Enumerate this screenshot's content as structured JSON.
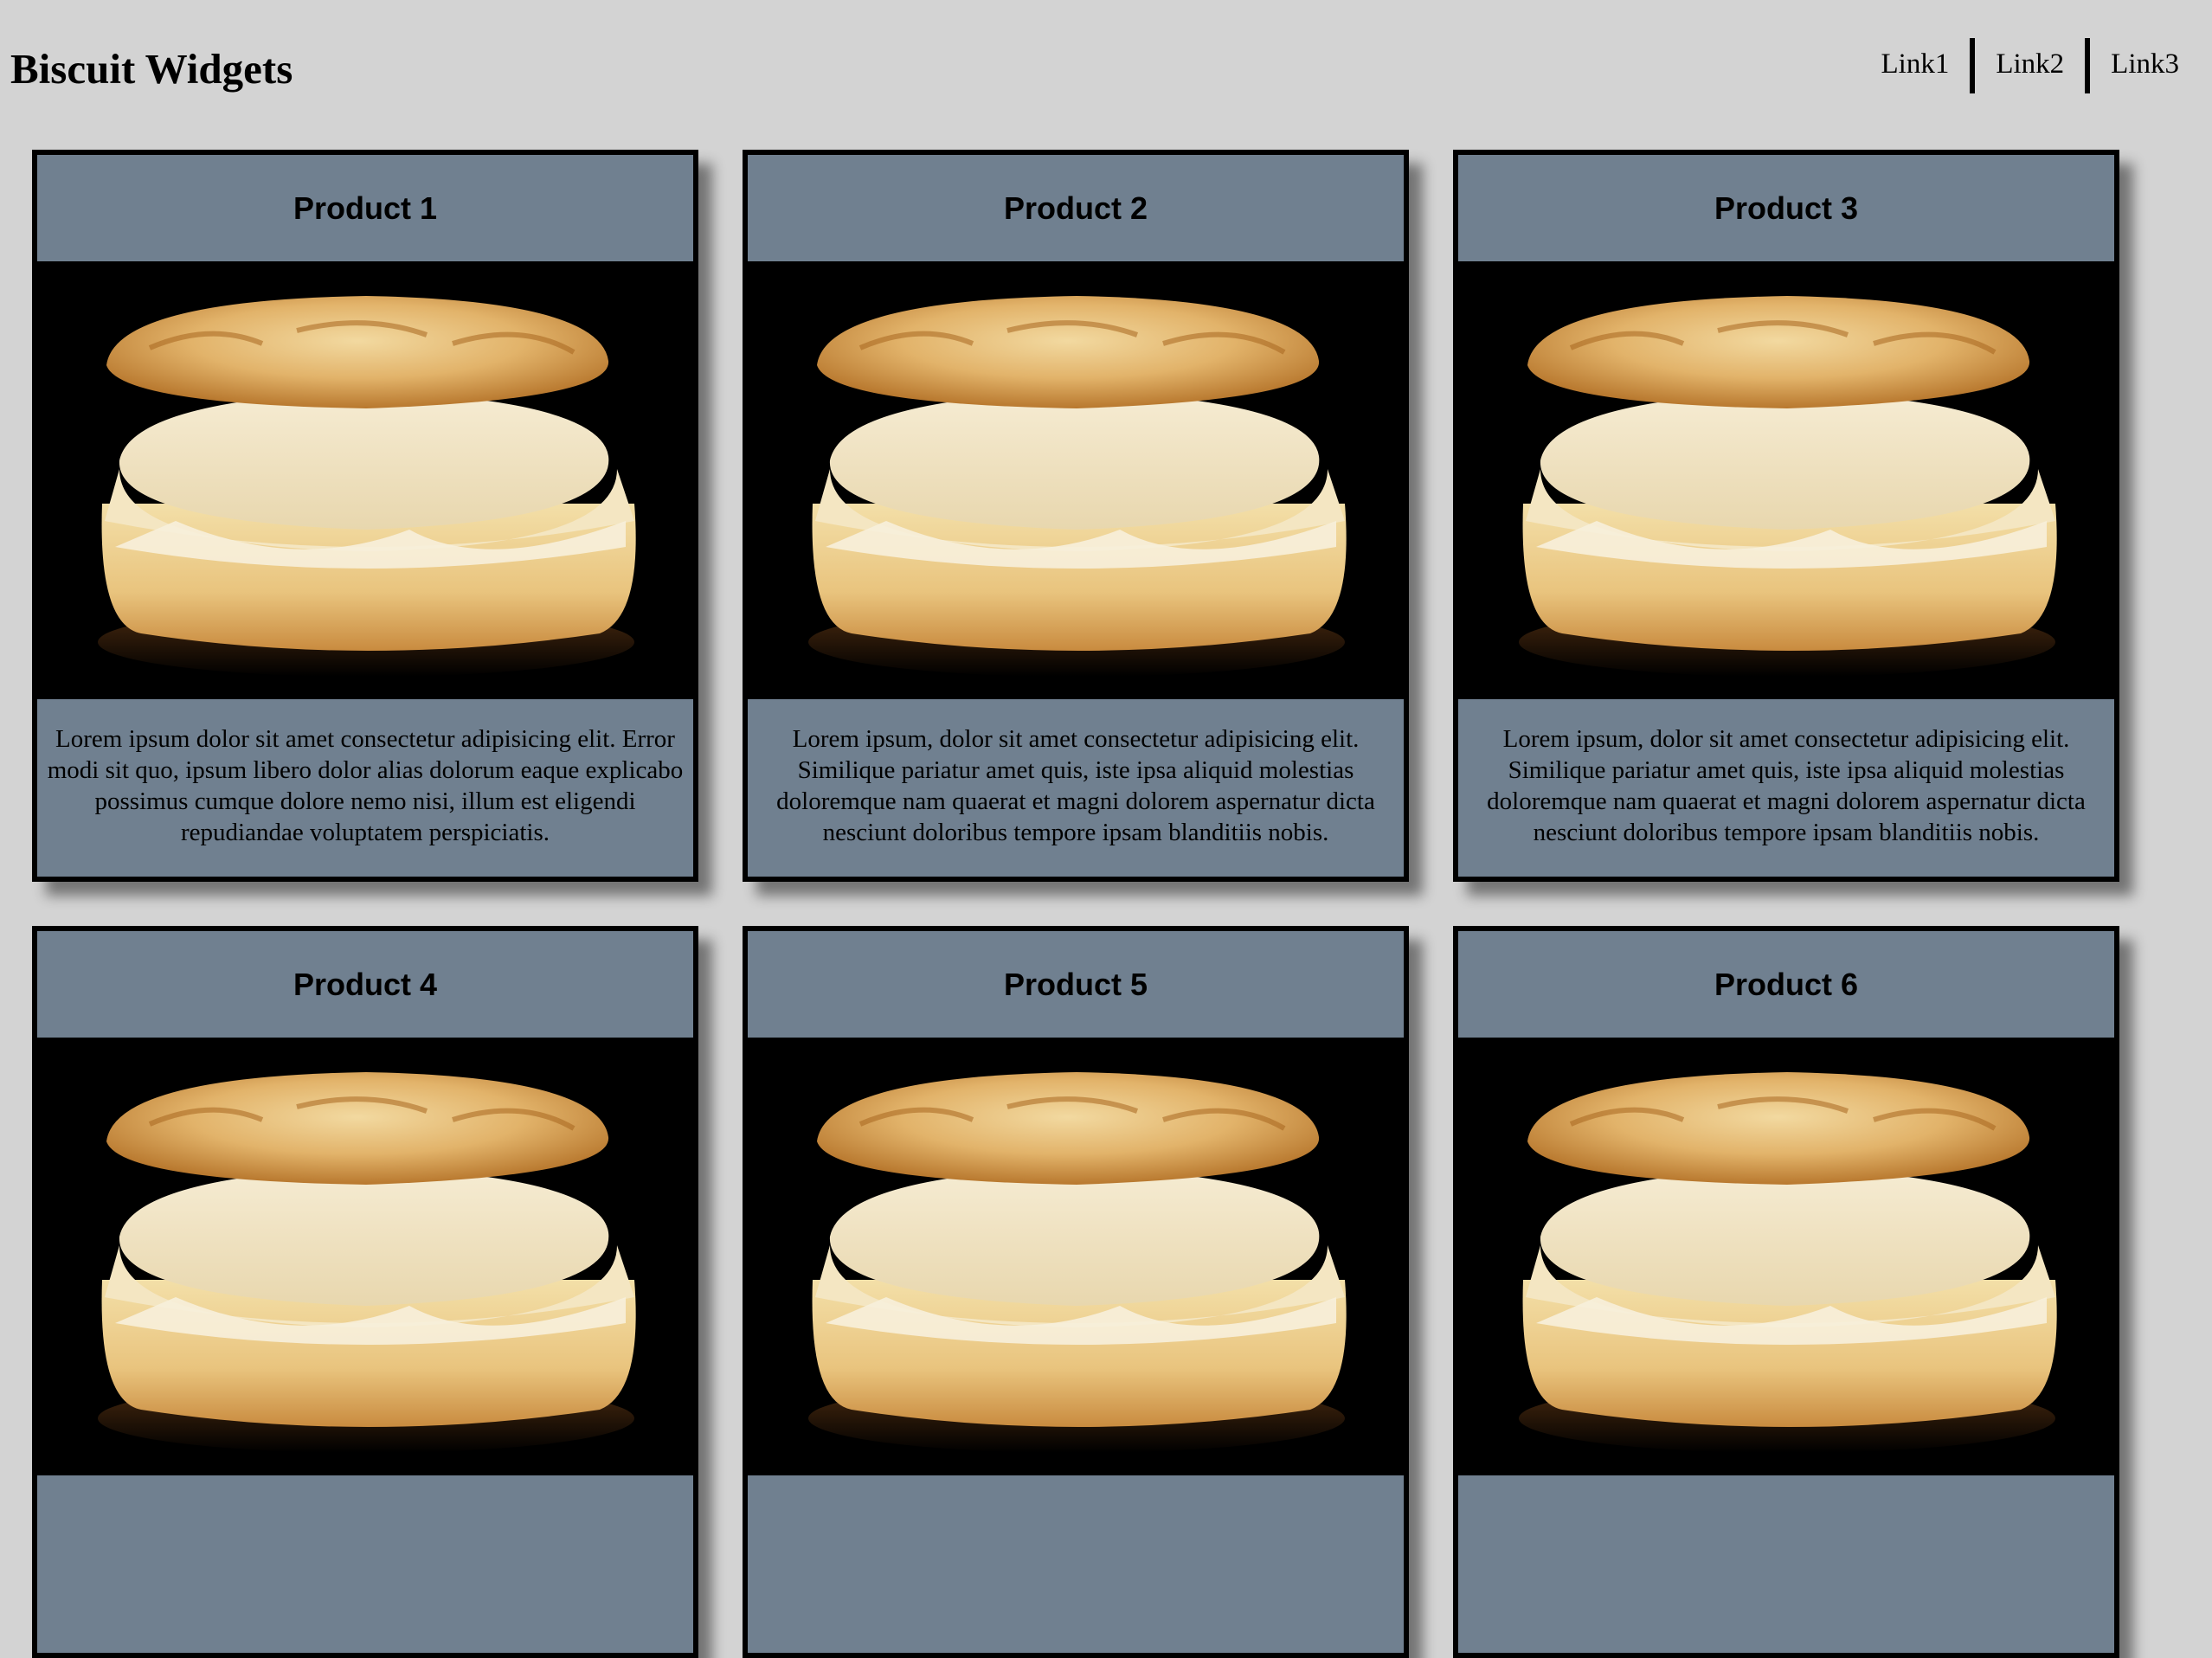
{
  "header": {
    "title": "Biscuit Widgets",
    "links": [
      "Link1",
      "Link2",
      "Link3"
    ]
  },
  "products": [
    {
      "title": "Product 1",
      "image": "biscuit-photo",
      "description": "Lorem ipsum dolor sit amet consectetur adipisicing elit. Error modi sit quo, ipsum libero dolor alias dolorum eaque explicabo possimus cumque dolore nemo nisi, illum est eligendi repudiandae voluptatem perspiciatis."
    },
    {
      "title": "Product 2",
      "image": "biscuit-photo",
      "description": "Lorem ipsum, dolor sit amet consectetur adipisicing elit. Similique pariatur amet quis, iste ipsa aliquid molestias doloremque nam quaerat et magni dolorem aspernatur dicta nesciunt doloribus tempore ipsam blanditiis nobis."
    },
    {
      "title": "Product 3",
      "image": "biscuit-photo",
      "description": "Lorem ipsum, dolor sit amet consectetur adipisicing elit. Similique pariatur amet quis, iste ipsa aliquid molestias doloremque nam quaerat et magni dolorem aspernatur dicta nesciunt doloribus tempore ipsam blanditiis nobis."
    },
    {
      "title": "Product 4",
      "image": "biscuit-photo",
      "description": ""
    },
    {
      "title": "Product 5",
      "image": "biscuit-photo",
      "description": ""
    },
    {
      "title": "Product 6",
      "image": "biscuit-photo",
      "description": ""
    }
  ],
  "colors": {
    "page_background": "#d3d3d3",
    "card_background": "#708090",
    "card_border": "#000000",
    "image_background": "#000000"
  }
}
